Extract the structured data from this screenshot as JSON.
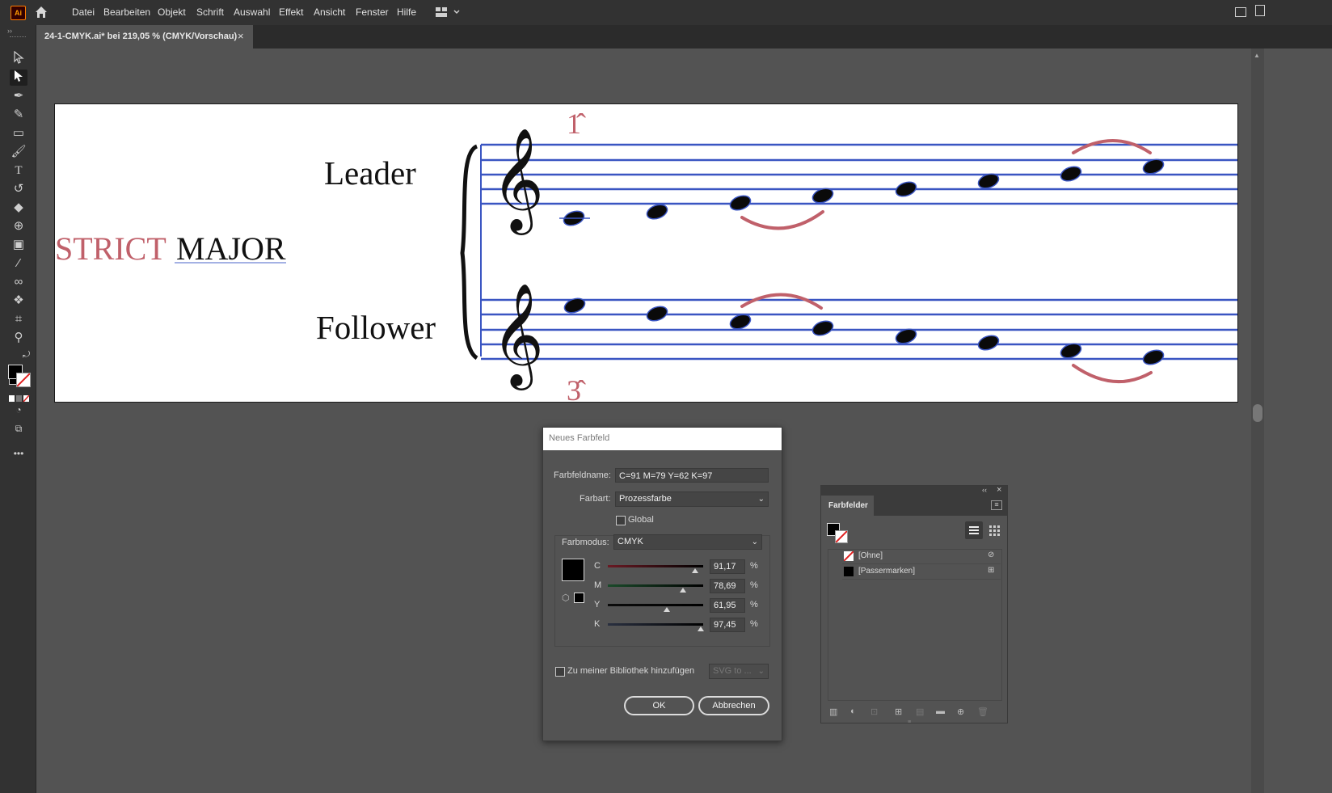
{
  "app": {
    "logo": "Ai"
  },
  "menu": [
    "Datei",
    "Bearbeiten",
    "Objekt",
    "Schrift",
    "Auswahl",
    "Effekt",
    "Ansicht",
    "Fenster",
    "Hilfe"
  ],
  "document_tab": {
    "title": "24-1-CMYK.ai* bei 219,05 % (CMYK/Vorschau)",
    "close": "×"
  },
  "artboard": {
    "strict": "STRICT",
    "major": "MAJOR",
    "leader": "Leader",
    "follower": "Follower",
    "degree_top": "1̂",
    "degree_bottom": "3̂"
  },
  "dialog": {
    "title": "Neues Farbfeld",
    "name_label": "Farbfeldname:",
    "name_value": "C=91 M=79 Y=62 K=97",
    "type_label": "Farbart:",
    "type_value": "Prozessfarbe",
    "global_label": "Global",
    "mode_label": "Farbmodus:",
    "mode_value": "CMYK",
    "channels": [
      {
        "label": "C",
        "value": "91,17",
        "unit": "%",
        "level": 0.9117
      },
      {
        "label": "M",
        "value": "78,69",
        "unit": "%",
        "level": 0.7869
      },
      {
        "label": "Y",
        "value": "61,95",
        "unit": "%",
        "level": 0.6195
      },
      {
        "label": "K",
        "value": "97,45",
        "unit": "%",
        "level": 0.9745
      }
    ],
    "library_label": "Zu meiner Bibliothek hinzufügen",
    "library_select": "SVG to ...",
    "ok": "OK",
    "cancel": "Abbrechen"
  },
  "swatches_panel": {
    "title": "Farbfelder",
    "collapse": "‹‹",
    "close": "×",
    "items": [
      {
        "name": "[Ohne]",
        "kind": "none"
      },
      {
        "name": "[Passermarken]",
        "kind": "registration"
      }
    ]
  }
}
